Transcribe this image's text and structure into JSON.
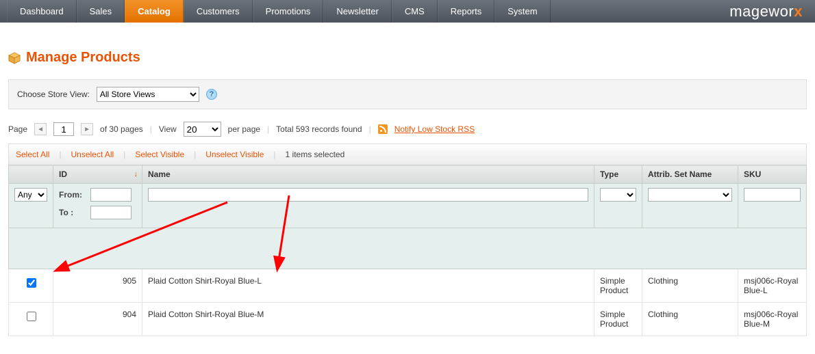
{
  "nav": {
    "items": [
      "Dashboard",
      "Sales",
      "Catalog",
      "Customers",
      "Promotions",
      "Newsletter",
      "CMS",
      "Reports",
      "System"
    ],
    "active_index": 2
  },
  "brand": {
    "prefix": "magewor",
    "accent": "x"
  },
  "page_title": "Manage Products",
  "store_view": {
    "label": "Choose Store View:",
    "selected": "All Store Views"
  },
  "pager": {
    "page_label": "Page",
    "page_value": "1",
    "of_pages": "of 30 pages",
    "view_label": "View",
    "per_page_value": "20",
    "per_page_suffix": "per page",
    "total": "Total 593 records found",
    "rss_label": "Notify Low Stock RSS"
  },
  "massaction": {
    "select_all": "Select All",
    "unselect_all": "Unselect All",
    "select_visible": "Select Visible",
    "unselect_visible": "Unselect Visible",
    "selected_text": "1 items selected"
  },
  "columns": {
    "id": "ID",
    "name": "Name",
    "type": "Type",
    "aset": "Attrib. Set Name",
    "sku": "SKU"
  },
  "filters": {
    "any_label": "Any",
    "from_label": "From:",
    "to_label": "To :"
  },
  "rows": [
    {
      "checked": true,
      "id": "905",
      "name": "Plaid Cotton Shirt-Royal Blue-L",
      "type": "Simple Product",
      "aset": "Clothing",
      "sku": "msj006c-Royal Blue-L"
    },
    {
      "checked": false,
      "id": "904",
      "name": "Plaid Cotton Shirt-Royal Blue-M",
      "type": "Simple Product",
      "aset": "Clothing",
      "sku": "msj006c-Royal Blue-M"
    }
  ]
}
